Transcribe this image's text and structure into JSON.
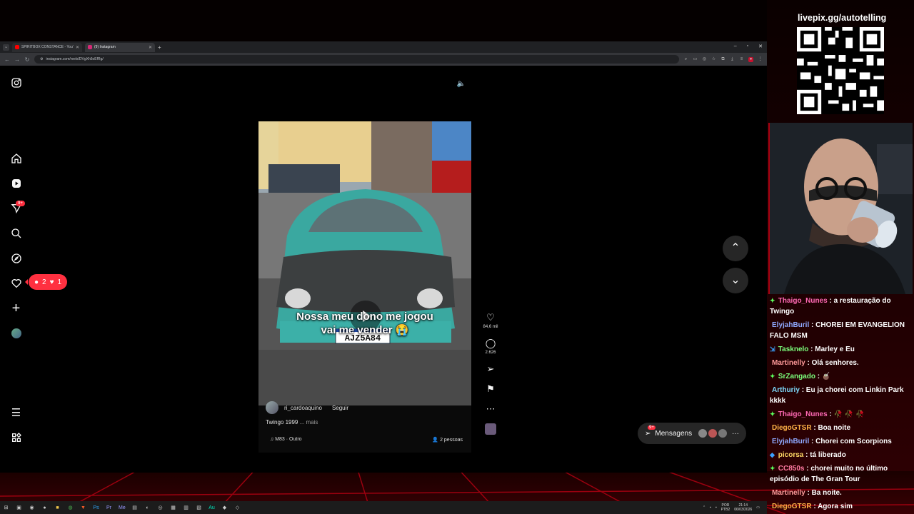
{
  "browser": {
    "tabs": [
      {
        "label": "SPIRITBOX CONSTANCE - YouT",
        "fav_color": "#ff0000"
      },
      {
        "label": "(9) Instagram",
        "fav_color": "#d62976"
      }
    ],
    "url": "instagram.com/reels/DVgXh6oEfRg/"
  },
  "instagram": {
    "sidebar_badge": "9+",
    "notif_comments": "2",
    "notif_likes": "1",
    "reel": {
      "caption_line1": "Nossa meu dono me jogou",
      "caption_line2": "vai me vender 😭",
      "username": "ri_cardoaquino",
      "follow": "Seguir",
      "description": "Twingo 1999",
      "more": "... mais",
      "audio": "M83 · Outro",
      "people": "2 pessoas",
      "plate": "AJZ5A84"
    },
    "likes": "84,6 mil",
    "comments": "2.626",
    "messages_label": "Mensagens",
    "messages_badge": "9+"
  },
  "taskbar": {
    "lang": "POR",
    "layout": "PTB2",
    "time": "21:14",
    "date": "06/03/2026"
  },
  "stream": {
    "livepix": "livepix.gg/autotelling",
    "chat": [
      {
        "user": "Thaigo_Nunes",
        "text": ": a restauração do Twingo",
        "color": "#ff69b4",
        "icon": "✦",
        "icon_color": "#5cff5c"
      },
      {
        "user": "ElyjahBuril",
        "text": ": CHOREI EM EVANGELION FALO MSM",
        "color": "#8fa8ff",
        "icon": "",
        "icon_color": ""
      },
      {
        "user": "Tasknelo",
        "text": ": Marley e Eu",
        "color": "#7cff7c",
        "icon": "⇲",
        "icon_color": "#3aa0ff"
      },
      {
        "user": "Martinelly",
        "text": ": Olá senhores.",
        "color": "#ff9a9a",
        "icon": "",
        "icon_color": ""
      },
      {
        "user": "SrZangado",
        "text": ": 🧉",
        "color": "#7cff7c",
        "icon": "✦",
        "icon_color": "#5cff5c"
      },
      {
        "user": "Arthuriy",
        "text": ": Eu ja chorei com Linkin Park kkkk",
        "color": "#7fdcff",
        "icon": "",
        "icon_color": ""
      },
      {
        "user": "Thaigo_Nunes",
        "text": ": 🥀 🥀 🥀",
        "color": "#ff69b4",
        "icon": "✦",
        "icon_color": "#5cff5c"
      },
      {
        "user": "DiegoGTSR",
        "text": ": Boa noite",
        "color": "#ffb347",
        "icon": "",
        "icon_color": ""
      },
      {
        "user": "ElyjahBuril",
        "text": ": Chorei com Scorpions",
        "color": "#8fa8ff",
        "icon": "",
        "icon_color": ""
      },
      {
        "user": "picorsa",
        "text": ": tá liberado",
        "color": "#ffd966",
        "icon": "◆",
        "icon_color": "#3aa0ff"
      },
      {
        "user": "CC850s",
        "text": ": chorei muito no último episódio de The Gran Tour",
        "color": "#ff7aa2",
        "icon": "✦",
        "icon_color": "#5cff5c"
      },
      {
        "user": "Martinelly",
        "text": ": Ba noite.",
        "color": "#ff9a9a",
        "icon": "",
        "icon_color": ""
      },
      {
        "user": "DiegoGTSR",
        "text": ": Agora sim",
        "color": "#ffb347",
        "icon": "",
        "icon_color": ""
      }
    ]
  }
}
